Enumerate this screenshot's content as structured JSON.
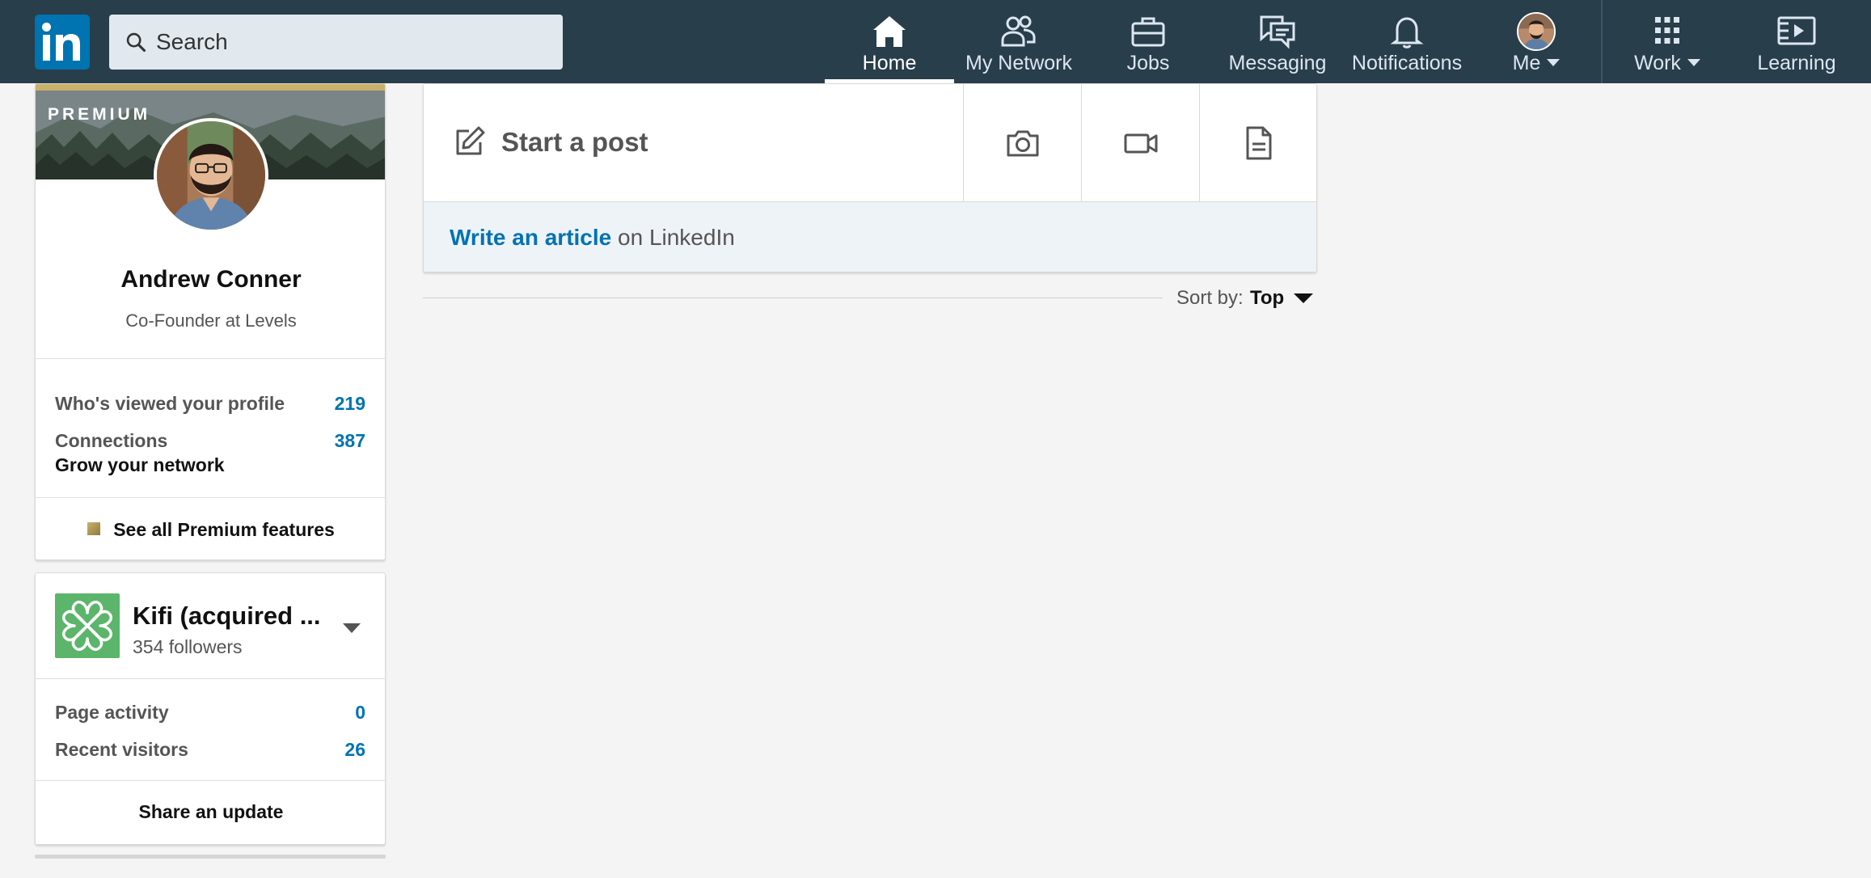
{
  "nav": {
    "search_placeholder": "Search",
    "items": [
      {
        "label": "Home",
        "icon": "home-icon"
      },
      {
        "label": "My Network",
        "icon": "people-icon"
      },
      {
        "label": "Jobs",
        "icon": "briefcase-icon"
      },
      {
        "label": "Messaging",
        "icon": "chat-icon"
      },
      {
        "label": "Notifications",
        "icon": "bell-icon"
      },
      {
        "label": "Me",
        "icon": "avatar"
      },
      {
        "label": "Work",
        "icon": "grid-icon"
      },
      {
        "label": "Learning",
        "icon": "learning-icon"
      }
    ],
    "logo_text": "in"
  },
  "profile": {
    "premium_label": "PREMIUM",
    "name": "Andrew Conner",
    "headline": "Co-Founder at Levels",
    "stats": [
      {
        "label": "Who's viewed your profile",
        "value": "219"
      },
      {
        "label": "Connections",
        "value": "387"
      }
    ],
    "grow_label": "Grow your network",
    "premium_features_label": "See all Premium features"
  },
  "company": {
    "name": "Kifi (acquired ...",
    "followers": "354 followers",
    "stats": [
      {
        "label": "Page activity",
        "value": "0"
      },
      {
        "label": "Recent visitors",
        "value": "26"
      }
    ],
    "share_label": "Share an update"
  },
  "share_box": {
    "start_post": "Start a post",
    "write_article_link": "Write an article",
    "write_article_rest": " on LinkedIn"
  },
  "sort": {
    "label": "Sort by:",
    "value": "Top"
  },
  "colors": {
    "nav_bg": "#283e4a",
    "brand_blue": "#0073b1",
    "premium_gold": "#c9b06b",
    "company_green": "#5bb56a"
  }
}
